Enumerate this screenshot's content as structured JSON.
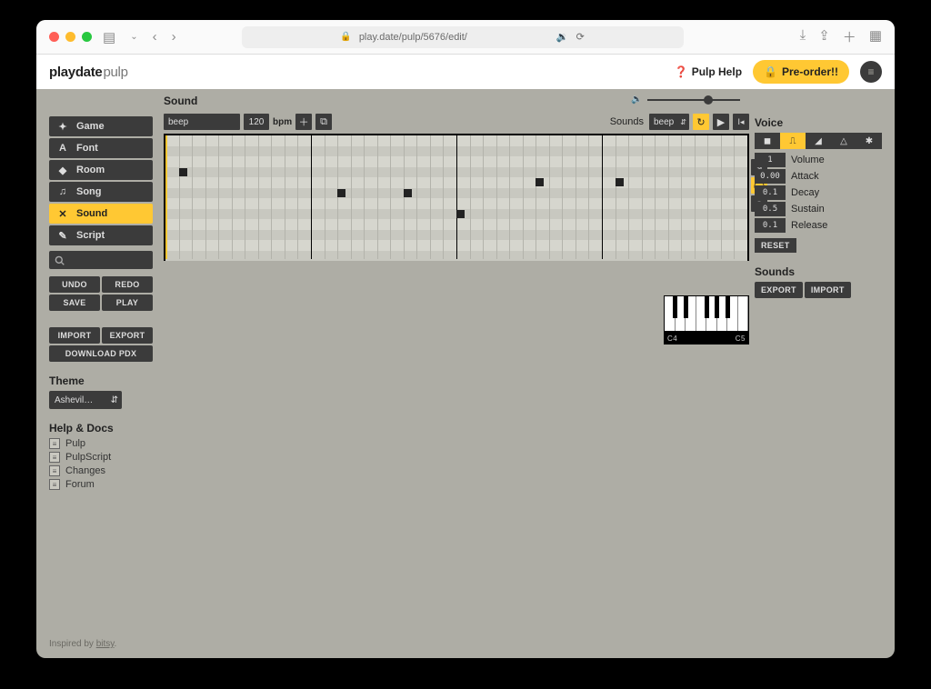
{
  "browser": {
    "url": "play.date/pulp/5676/edit/"
  },
  "header": {
    "logo_main": "playdate",
    "logo_sub": "pulp",
    "help_label": "Pulp Help",
    "preorder_label": "Pre-order!!"
  },
  "sidebar": {
    "items": [
      {
        "icon": "✦",
        "label": "Game"
      },
      {
        "icon": "A",
        "label": "Font"
      },
      {
        "icon": "◆",
        "label": "Room"
      },
      {
        "icon": "♫",
        "label": "Song"
      },
      {
        "icon": "✕",
        "label": "Sound",
        "active": true
      },
      {
        "icon": "✎",
        "label": "Script"
      }
    ],
    "undo": "UNDO",
    "redo": "REDO",
    "save": "SAVE",
    "play": "PLAY",
    "import": "IMPORT",
    "export": "EXPORT",
    "download": "DOWNLOAD PDX",
    "theme_title": "Theme",
    "theme_value": "Ashevil…",
    "help_title": "Help & Docs",
    "docs": [
      "Pulp",
      "PulpScript",
      "Changes",
      "Forum"
    ]
  },
  "main": {
    "title": "Sound",
    "name": "beep",
    "bpm_value": "120",
    "bpm_label": "bpm",
    "sounds_label": "Sounds",
    "sound_selected": "beep",
    "notes": [
      {
        "col": 1,
        "row": 3
      },
      {
        "col": 13,
        "row": 5
      },
      {
        "col": 18,
        "row": 5
      },
      {
        "col": 22,
        "row": 7
      },
      {
        "col": 28,
        "row": 4
      },
      {
        "col": 34,
        "row": 4
      }
    ],
    "keyboard": {
      "low": "C4",
      "high": "C5"
    }
  },
  "voice": {
    "title": "Voice",
    "params": [
      {
        "value": "1",
        "label": "Volume"
      },
      {
        "value": "0.00",
        "label": "Attack"
      },
      {
        "value": "0.1",
        "label": "Decay"
      },
      {
        "value": "0.5",
        "label": "Sustain"
      },
      {
        "value": "0.1",
        "label": "Release"
      }
    ],
    "reset": "RESET",
    "sounds_title": "Sounds",
    "export": "EXPORT",
    "import": "IMPORT"
  },
  "footer": {
    "prefix": "Inspired by ",
    "link": "bitsy",
    "suffix": "."
  }
}
